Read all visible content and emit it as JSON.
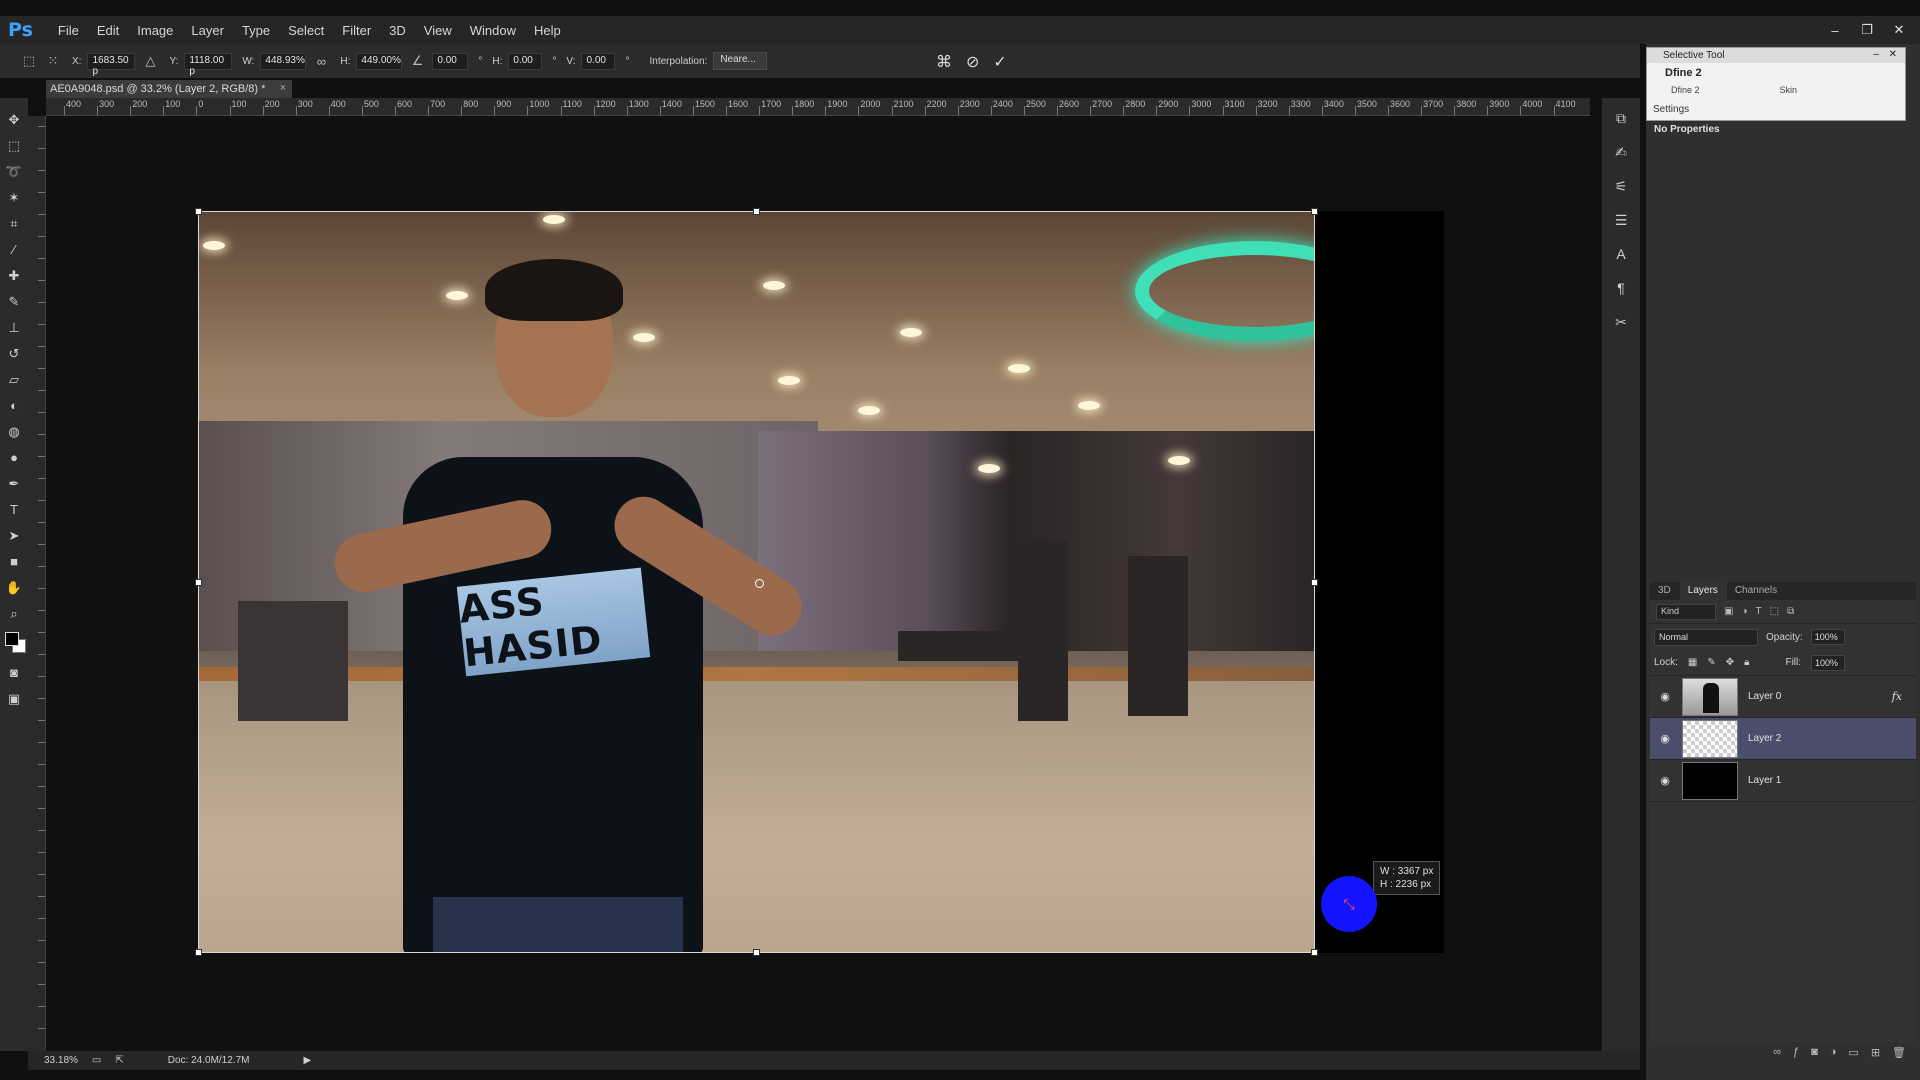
{
  "app": {
    "logo": "Ps",
    "menu": [
      "File",
      "Edit",
      "Image",
      "Layer",
      "Type",
      "Select",
      "Filter",
      "3D",
      "View",
      "Window",
      "Help"
    ],
    "window_controls": {
      "minimize": "–",
      "restore": "❐",
      "close": "✕"
    }
  },
  "options_bar": {
    "x_label": "X:",
    "x_value": "1683.50 p",
    "y_label": "Y:",
    "y_value": "1118.00 p",
    "w_label": "W:",
    "w_value": "448.93%",
    "h_label": "H:",
    "h_value": "449.00%",
    "angle_value": "0.00",
    "hskew_label": "H:",
    "hskew_value": "0.00",
    "vskew_label": "V:",
    "vskew_value": "0.00",
    "interpolation_label": "Interpolation:",
    "interpolation_value": "Neare..."
  },
  "document": {
    "tab_title": "AE0A9048.psd @ 33.2% (Layer 2, RGB/8) *",
    "tab_close": "×"
  },
  "ruler_h": [
    "400",
    "300",
    "200",
    "100",
    "0",
    "100",
    "200",
    "300",
    "400",
    "500",
    "600",
    "700",
    "800",
    "900",
    "1000",
    "1100",
    "1200",
    "1300",
    "1400",
    "1500",
    "1600",
    "1700",
    "1800",
    "1900",
    "2000",
    "2100",
    "2200",
    "2300",
    "2400",
    "2500",
    "2600",
    "2700",
    "2800",
    "2900",
    "3000",
    "3100",
    "3200",
    "3300",
    "3400",
    "3500",
    "3600",
    "3700",
    "3800",
    "3900",
    "4000",
    "4100"
  ],
  "canvas": {
    "shirt_text": "ASS HASID",
    "tooltip_w": "W : 3367 px",
    "tooltip_h": "H : 2236 px"
  },
  "status": {
    "zoom": "33.18%",
    "doc": "Doc: 24.0M/12.7M"
  },
  "selective_tool": {
    "title": "Selective Tool",
    "header": "Dfine 2",
    "row_left": "Dfine 2",
    "row_right": "Skin",
    "settings": "Settings",
    "min": "–",
    "close": "✕"
  },
  "properties": {
    "empty_label": "No Properties"
  },
  "layers_panel": {
    "tabs": [
      "3D",
      "Layers",
      "Channels"
    ],
    "kind_placeholder": "Kind",
    "blend_mode": "Normal",
    "opacity_label": "Opacity:",
    "opacity_value": "100%",
    "lock_label": "Lock:",
    "fill_label": "Fill:",
    "fill_value": "100%",
    "layers": [
      {
        "name": "Layer 0",
        "fx": "fx"
      },
      {
        "name": "Layer 2"
      },
      {
        "name": "Layer 1"
      }
    ]
  }
}
